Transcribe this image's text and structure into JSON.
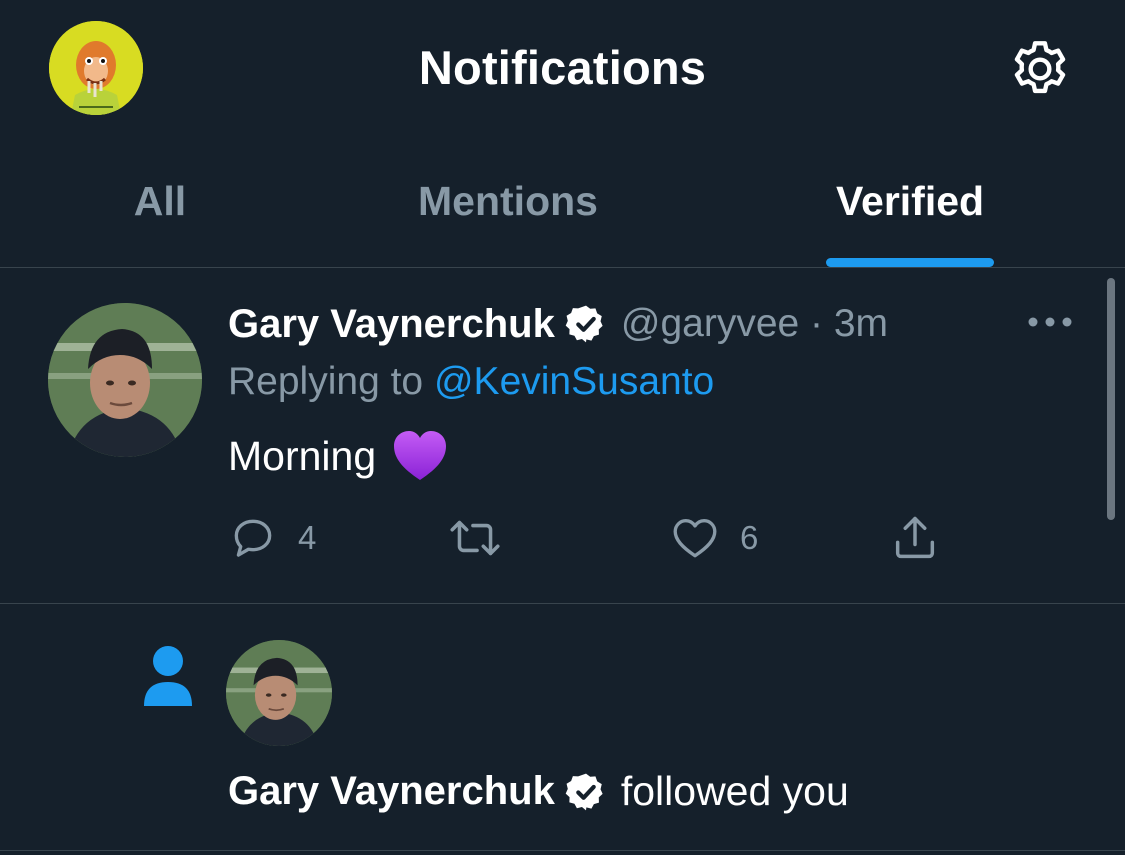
{
  "header": {
    "title": "Notifications",
    "avatar_icon": "user-avatar-ape-icon",
    "settings_icon": "gear-icon"
  },
  "tabs": [
    {
      "label": "All",
      "active": false
    },
    {
      "label": "Mentions",
      "active": false
    },
    {
      "label": "Verified",
      "active": true
    }
  ],
  "tweet": {
    "author_name": "Gary Vaynerchuk",
    "verified_icon": "verified-badge-icon",
    "handle_time": "@garyvee · 3m",
    "replying_prefix": "Replying to",
    "replying_to": "@KevinSusanto",
    "text": "Morning",
    "emoji": "purple-heart-icon",
    "actions": {
      "reply_count": "4",
      "retweet_count": "",
      "like_count": "6"
    }
  },
  "follow_notification": {
    "icon": "person-icon",
    "name": "Gary Vaynerchuk",
    "action_text": "followed you"
  },
  "colors": {
    "background": "#15202b",
    "accent": "#1d9bf0",
    "secondary_text": "#8899a6",
    "divider": "#38444d",
    "purple_heart": "#a838ec"
  }
}
